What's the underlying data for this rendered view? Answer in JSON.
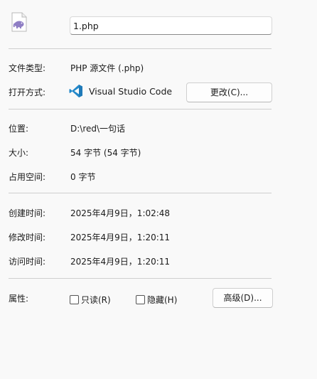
{
  "file": {
    "icon": "php-elephant-file-icon",
    "name_value": "1.php"
  },
  "rows": {
    "type": {
      "label": "文件类型:",
      "value": "PHP 源文件 (.php)"
    },
    "open_with": {
      "label": "打开方式:",
      "app_name": "Visual Studio Code",
      "app_icon": "vscode-icon",
      "change_button": "更改(C)..."
    },
    "location": {
      "label": "位置:",
      "value": "D:\\red\\一句话"
    },
    "size": {
      "label": "大小:",
      "value": "54 字节 (54 字节)"
    },
    "size_on_disk": {
      "label": "占用空间:",
      "value": "0 字节"
    },
    "created": {
      "label": "创建时间:",
      "value": "2025年4月9日，1:02:48"
    },
    "modified": {
      "label": "修改时间:",
      "value": "2025年4月9日，1:20:11"
    },
    "accessed": {
      "label": "访问时间:",
      "value": "2025年4月9日，1:20:11"
    }
  },
  "attributes": {
    "label": "属性:",
    "readonly_label": "只读(R)",
    "hidden_label": "隐藏(H)",
    "readonly_checked": false,
    "hidden_checked": false,
    "advanced_button": "高级(D)..."
  },
  "colors": {
    "background": "#f9f9f9",
    "separator": "#cfcfcf",
    "vscode_blue": "#2489ca",
    "php_purple": "#8f7ec4"
  }
}
